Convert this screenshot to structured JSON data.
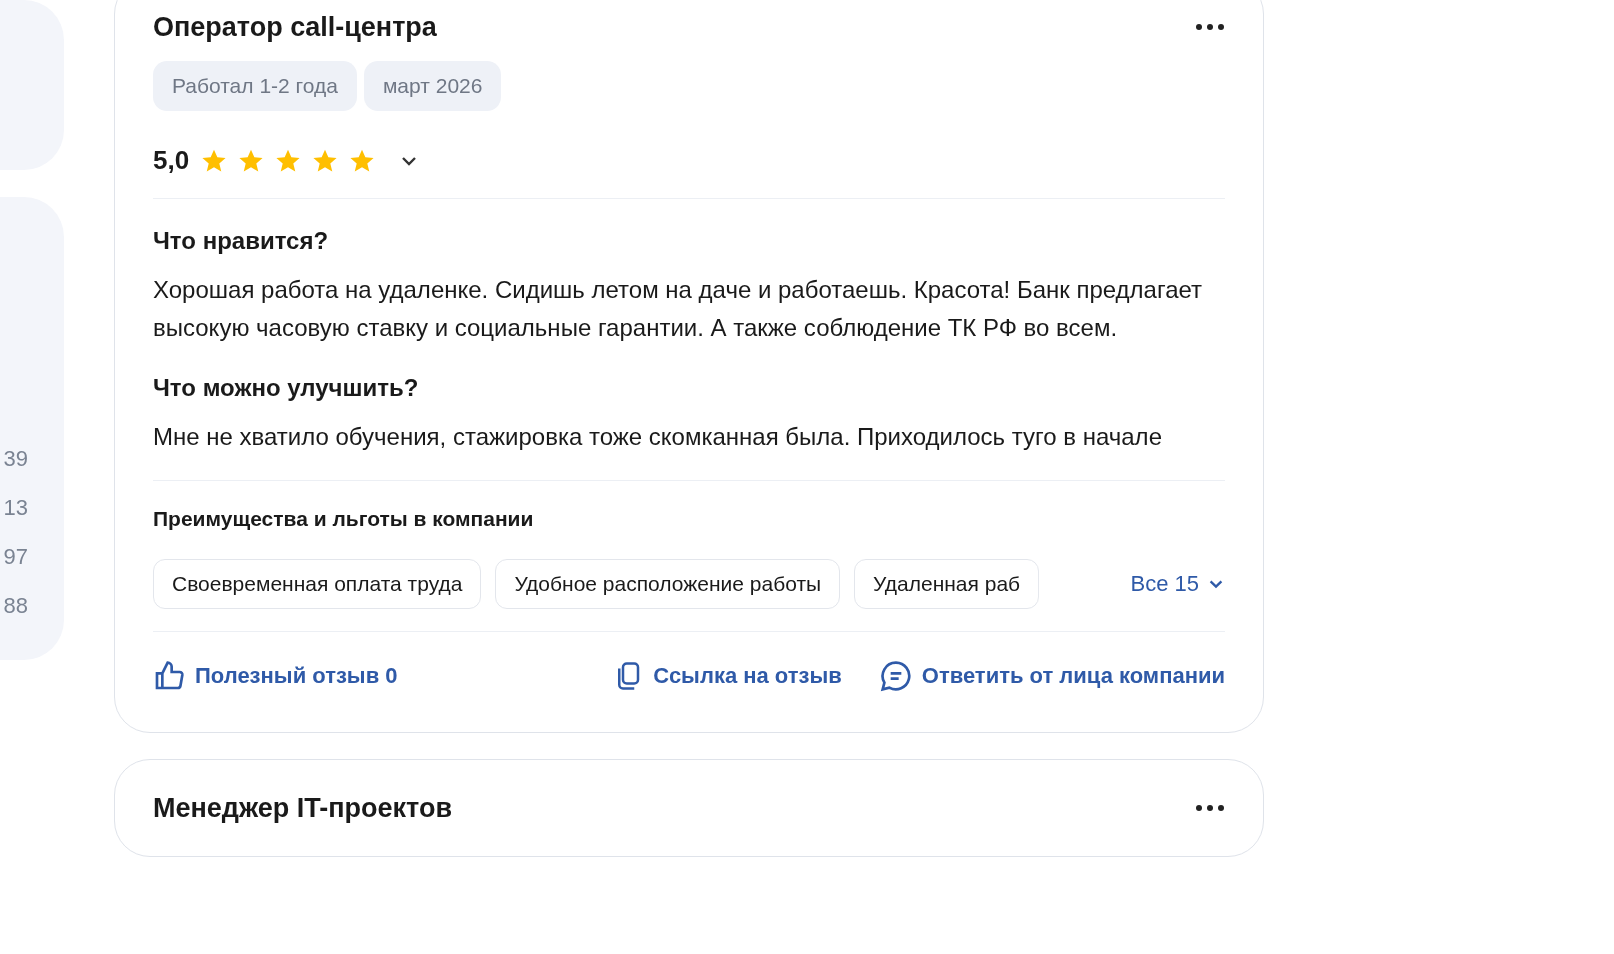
{
  "sidebar": {
    "numbers": [
      "39",
      "13",
      "97",
      "88"
    ]
  },
  "reviews": [
    {
      "title": "Оператор call-центра",
      "tags": [
        "Работал 1-2 года",
        "март 2026"
      ],
      "rating": "5,0",
      "stars": 5,
      "expanded": false,
      "sections": [
        {
          "heading": "Что нравится?",
          "text": "Хорошая работа на удаленке. Сидишь летом на даче и работаешь. Красота! Банк предлагает высокую часовую ставку и социальные гарантии. А также соблюдение ТК РФ во всем."
        },
        {
          "heading": "Что можно улучшить?",
          "text": "Мне не хватило обучения, стажировка тоже скомканная была. Приходилось туго в начале"
        }
      ],
      "benefits": {
        "heading": "Преимущества и льготы в компании",
        "items": [
          "Своевременная оплата труда",
          "Удобное расположение работы",
          "Удаленная раб"
        ],
        "all": "Все 15"
      },
      "actions": {
        "useful": "Полезный отзыв 0",
        "link": "Ссылка на отзыв",
        "reply": "Ответить от лица компании"
      }
    },
    {
      "title": "Менеджер IT-проектов"
    }
  ]
}
